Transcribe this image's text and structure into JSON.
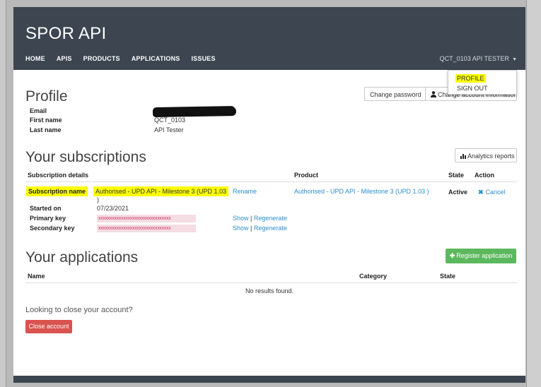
{
  "header": {
    "brand": "SPOR API",
    "nav": [
      "HOME",
      "APIS",
      "PRODUCTS",
      "APPLICATIONS",
      "ISSUES"
    ],
    "user": "QCT_0103 API TESTER",
    "dropdown": [
      "PROFILE",
      "SIGN OUT"
    ]
  },
  "profile": {
    "title": "Profile",
    "change_password": "Change password",
    "change_account": "Change account information",
    "fields": [
      {
        "label": "Email",
        "value": ""
      },
      {
        "label": "First name",
        "value": "QCT_0103"
      },
      {
        "label": "Last name",
        "value": "API Tester"
      }
    ]
  },
  "subscriptions": {
    "title": "Your subscriptions",
    "analytics": "Analytics reports",
    "columns": [
      "Subscription details",
      "Product",
      "State",
      "Action"
    ],
    "name_label": "Subscription name",
    "name_value_line1": "Authorised - UPD API - Milestone 3 (UPD 1.03",
    "name_value_line2": ")",
    "rename": "Rename",
    "product": "Authorised - UPD API - Milestone 3 (UPD 1.03 )",
    "state": "Active",
    "cancel": "Cancel",
    "started_label": "Started on",
    "started_value": "07/23/2021",
    "primary_label": "Primary key",
    "secondary_label": "Secondary key",
    "key_mask": "xxxxxxxxxxxxxxxxxxxxxxxxxxxxxxxx",
    "show": "Show",
    "separator": "|",
    "regenerate": "Regenerate"
  },
  "applications": {
    "title": "Your applications",
    "register": "Register application",
    "columns": [
      "Name",
      "Category",
      "State"
    ],
    "empty": "No results found."
  },
  "close": {
    "question": "Looking to close your account?",
    "button": "Close account"
  },
  "colors": {
    "highlight": "#fbff00",
    "link": "#2a8fd0",
    "navbar": "#3c4550",
    "green": "#5cb85c",
    "red": "#d9534f"
  }
}
